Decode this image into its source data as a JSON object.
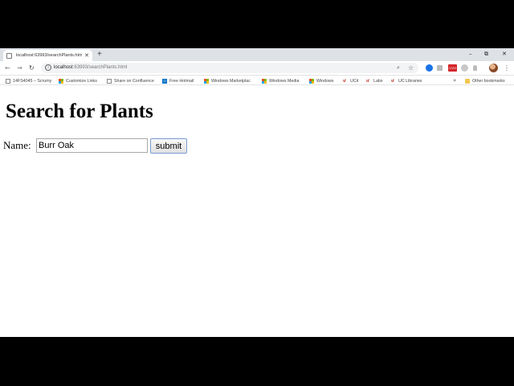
{
  "browser": {
    "tab_title": "localhost:63993/searchPlants.html",
    "new_tab": "+",
    "window_controls": {
      "minimize": "–",
      "restore": "⧉",
      "close": "✕"
    },
    "address": {
      "host": "localhost",
      "path": ":63993/searchPlants.html"
    },
    "bookmarks": [
      {
        "label": "14FS4045 – Scrumy",
        "icon": "doc"
      },
      {
        "label": "Customize Links",
        "icon": "ms"
      },
      {
        "label": "Share on Confluence",
        "icon": "doc"
      },
      {
        "label": "Free Hotmail",
        "icon": "ol"
      },
      {
        "label": "Windows Marketplac",
        "icon": "ms"
      },
      {
        "label": "Windows Media",
        "icon": "ms"
      },
      {
        "label": "Windows",
        "icon": "ms"
      },
      {
        "label": "UCit",
        "icon": "ucit"
      },
      {
        "label": "Labs",
        "icon": "ucit"
      },
      {
        "label": "UC Libraries",
        "icon": "ucit"
      }
    ],
    "more_bookmarks": "»",
    "other_bookmarks": "Other bookmarks"
  },
  "page": {
    "title": "Search for Plants",
    "name_label": "Name:",
    "name_value": "Burr Oak",
    "submit_label": "submit"
  },
  "colors": {
    "accent": "#4285f4",
    "button_border": "#7a9cd3"
  }
}
